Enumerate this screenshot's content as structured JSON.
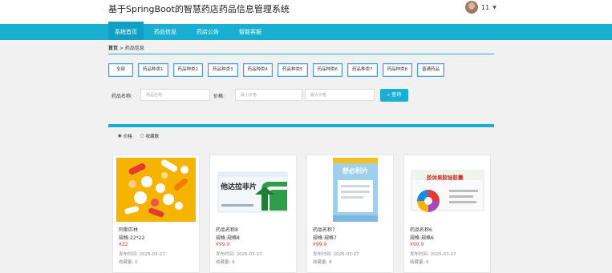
{
  "header": {
    "title": "基于SpringBoot的智慧药店药品信息管理系统",
    "username": "11"
  },
  "nav": [
    {
      "label": "系统首页",
      "active": true
    },
    {
      "label": "药品信息",
      "active": false
    },
    {
      "label": "药店公告",
      "active": false
    },
    {
      "label": "智能客服",
      "active": false
    }
  ],
  "breadcrumb": {
    "home": "首页",
    "sep": ">",
    "current": "药品信息"
  },
  "categories": [
    "全部",
    "药品种类1",
    "药品种类2",
    "药品种类3",
    "药品种类4",
    "药品种类5",
    "药品种类6",
    "药品种类7",
    "药品种类8",
    "普通药品"
  ],
  "search": {
    "name_label": "药品名称:",
    "name_placeholder": "药品名称",
    "price_label": "价格:",
    "min_placeholder": "最小价格",
    "max_placeholder": "最大价格",
    "button": "查询"
  },
  "sort": [
    {
      "label": "价格",
      "selected": true
    },
    {
      "label": "收藏数",
      "selected": false
    }
  ],
  "cards": [
    {
      "name": "阿斯匹林",
      "spec": "规格:22*22",
      "price": "¥22",
      "date": "发布时间: 2025-03-27",
      "fav": "收藏量: 0"
    },
    {
      "name": "药品名称8",
      "spec": "规格:规格8",
      "price": "¥99.9",
      "date": "发布时间: 2025-03-27",
      "fav": "收藏量: 8"
    },
    {
      "name": "药品名称7",
      "spec": "规格:规格7",
      "price": "¥99.9",
      "date": "发布时间: 2025-03-27",
      "fav": "收藏量: 8"
    },
    {
      "name": "药品名称6",
      "spec": "规格:规格6",
      "price": "¥99.9",
      "date": "发布时间: 2025-03-27",
      "fav": "收藏量: 6"
    }
  ],
  "box_labels": {
    "tadalafil": "他达拉非片",
    "sulpiride": "舒必利片",
    "capsule": "胶体果胶铋胶囊"
  },
  "colors": {
    "accent": "#1aaed0",
    "price": "#e53935"
  }
}
